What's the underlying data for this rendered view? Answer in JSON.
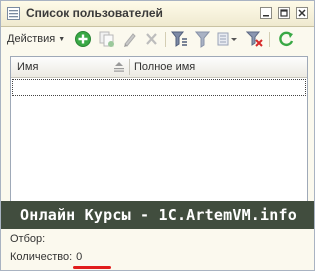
{
  "window": {
    "title": "Список пользователей",
    "title_icon": "users-list-icon",
    "controls": [
      "minimize-icon",
      "maximize-icon",
      "close-icon"
    ]
  },
  "toolbar": {
    "actions_label": "Действия",
    "buttons": [
      "add-icon",
      "copy-icon",
      "edit-icon",
      "delete-icon",
      "filter-settings-icon",
      "filter-icon",
      "filter-dropdown-icon",
      "clear-filter-icon",
      "refresh-icon"
    ]
  },
  "table": {
    "columns": [
      "Имя",
      "Полное имя"
    ],
    "rows": []
  },
  "banner": {
    "text": "Онлайн Курсы - 1C.ArtemVM.info"
  },
  "footer": {
    "filter_label": "Отбор:",
    "count_label": "Количество:",
    "count_value": "0"
  },
  "colors": {
    "window_bg": "#fbf9ee",
    "banner_bg": "#414d3e",
    "accent_green": "#39a845",
    "underline_red": "#e11d1d"
  }
}
